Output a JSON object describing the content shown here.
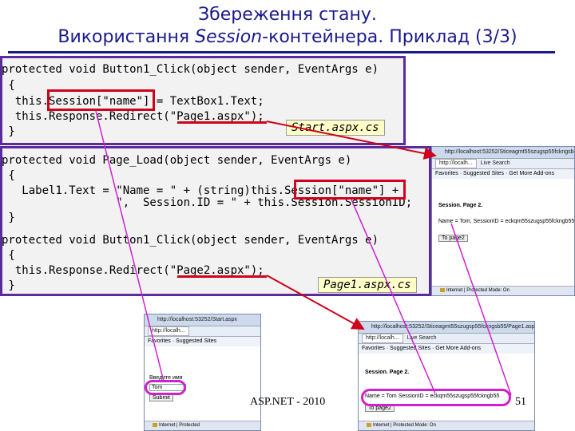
{
  "title": {
    "line1": "Збереження стану.",
    "line2_a": "Використання ",
    "line2_b": "Session",
    "line2_c": "-контейнера. Приклад   (3/3)"
  },
  "start_panel": {
    "lines": [
      "protected void Button1_Click(object sender, EventArgs e)",
      " {",
      "  this.Session[\"name\"] = TextBox1.Text;",
      "  this.Response.Redirect(\"Page1.aspx\");",
      " }"
    ],
    "file_tag": "Start.aspx.cs"
  },
  "page1_panel": {
    "lines": [
      "protected void Page_Load(object sender, EventArgs e)",
      " {",
      "   Label1.Text = \"Name = \" + (string)this.Session[\"name\"] +",
      "                 \",  Session.ID = \" + this.Session.SessionID;",
      " }",
      "",
      "protected void Button1_Click(object sender, EventArgs e)",
      " {",
      "  this.Response.Redirect(\"Page2.aspx\");",
      " }"
    ],
    "file_tag": "Page1.aspx.cs"
  },
  "browser_page1": {
    "address": "http://localhost:53252/Sticeagmt55szugsp55fckngsb55/Page1",
    "tab": "http://localh...",
    "tab2": "Live Search",
    "favorites": "Favorites",
    "suggested": "Suggested Sites",
    "addons": "Get More Add-ons",
    "heading": "Session. Page 2.",
    "label_text": "Name = Tom, SessionID = eckqm55szugsp55fckngb55",
    "button": "To page2",
    "status": "Internet | Protected Mode: On"
  },
  "browser_start": {
    "address": "http://localhost:53252/Start.aspx",
    "tab": "http://localh...",
    "favorites": "Favorites",
    "suggested": "Suggested Sites",
    "prompt": "Введите имя",
    "input_value": "Tom",
    "button": "Submit",
    "status": "Internet | Protected"
  },
  "browser_page2": {
    "address": "http://localhost:53252/Sticeagmt55szugsp55fckngsb55/Page1.aspx",
    "tab": "http://localh...",
    "tab2": "Live Search",
    "favorites": "Favorites",
    "suggested": "Suggested Sites",
    "addons": "Get More Add-ons",
    "heading": "Session. Page 2.",
    "label_text": "Name = Tom SessionID = eckqm55szugsp55fckngb55",
    "button": "To page2",
    "status": "Internet | Protected Mode: On"
  },
  "footer": {
    "center": "ASP.NET - 2010",
    "page_number": "51"
  },
  "colors": {
    "title": "#1a1a8c",
    "panel_border": "#5b2a9e",
    "highlight_red": "#d0021b",
    "highlight_magenta": "#d020d0",
    "file_tag_bg": "#ffffc8"
  }
}
